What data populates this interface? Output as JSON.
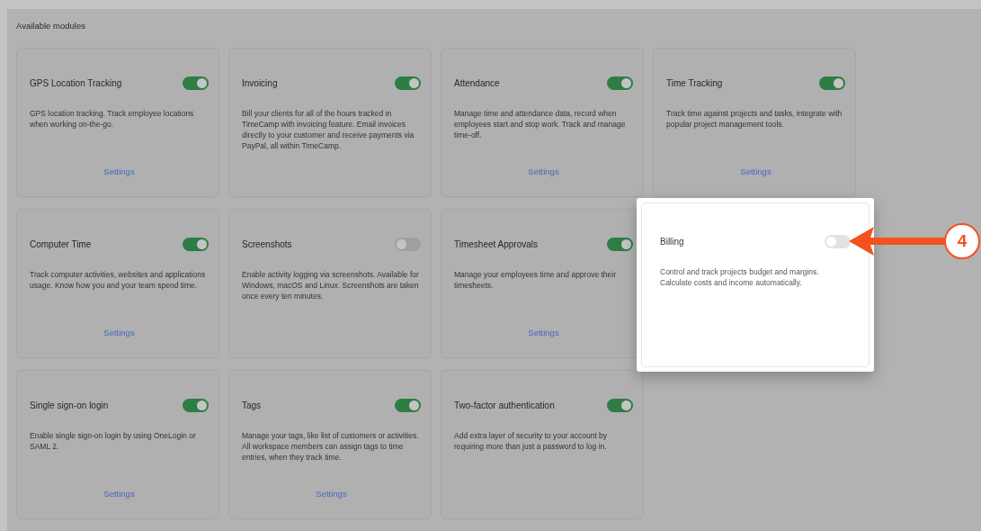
{
  "heading": "Available modules",
  "modules": [
    {
      "title": "GPS Location Tracking",
      "enabled": true,
      "highlighted": false,
      "description": "GPS location tracking. Track employee locations when working on-the-go.",
      "link": "Settings"
    },
    {
      "title": "Invoicing",
      "enabled": true,
      "highlighted": false,
      "description": "Bill your clients for all of the hours tracked in TimeCamp with invoicing feature. Email invoices directly to your customer and receive payments via PayPal, all within TimeCamp."
    },
    {
      "title": "Attendance",
      "enabled": true,
      "highlighted": false,
      "description": "Manage time and attendance data, record when employees start and stop work. Track and manage time-off.",
      "link": "Settings"
    },
    {
      "title": "Time Tracking",
      "enabled": true,
      "highlighted": false,
      "description": "Track time against projects and tasks, integrate with popular project management tools.",
      "link": "Settings"
    },
    {
      "title": "Computer Time",
      "enabled": true,
      "highlighted": false,
      "description": "Track computer activities, websites and applications usage. Know how you and your team spend time.",
      "link": "Settings"
    },
    {
      "title": "Screenshots",
      "enabled": false,
      "highlighted": false,
      "description": "Enable activity logging via screenshots. Available for Windows, macOS and Linux. Screenshots are taken once every ten minutes."
    },
    {
      "title": "Timesheet Approvals",
      "enabled": true,
      "highlighted": false,
      "description": "Manage your employees time and approve their timesheets.",
      "link": "Settings"
    },
    {
      "title": "Billing",
      "enabled": false,
      "highlighted": true,
      "description": "Control and track projects budget and margins. Calculate costs and income automatically."
    },
    {
      "title": "Single sign-on login",
      "enabled": true,
      "highlighted": false,
      "description": "Enable single sign-on login by using OneLogin or SAML 2.",
      "link": "Settings"
    },
    {
      "title": "Tags",
      "enabled": true,
      "highlighted": false,
      "description": "Manage your tags, like list of customers or activities. All workspace members can assign tags to time entries, when they track time.",
      "link": "Settings"
    },
    {
      "title": "Two-factor authentication",
      "enabled": true,
      "highlighted": false,
      "description": "Add extra layer of security to your account by requiring more than just a password to log in."
    }
  ],
  "callout": {
    "number": "4"
  }
}
